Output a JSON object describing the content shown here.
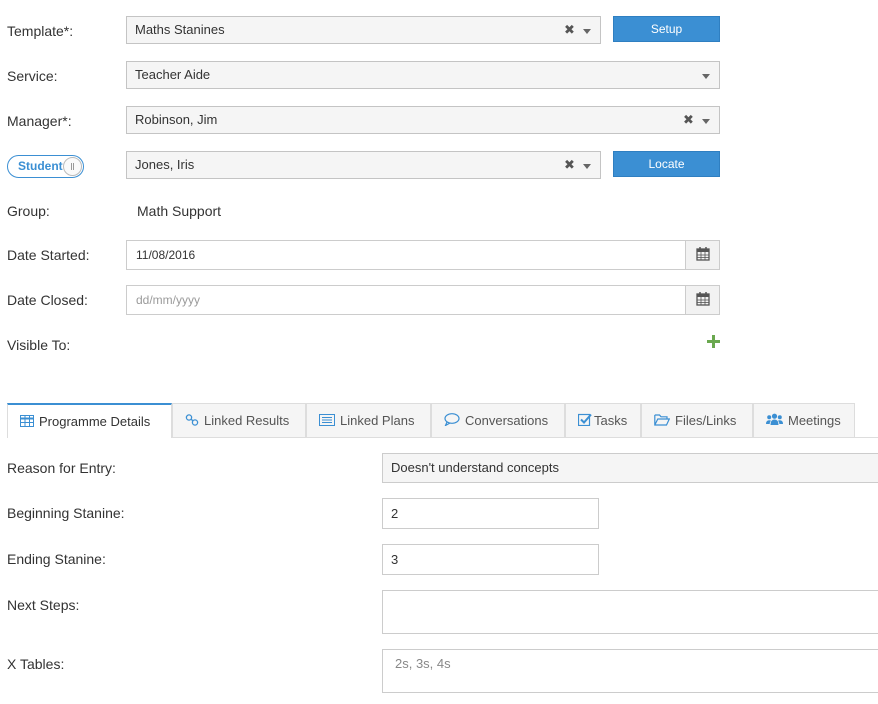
{
  "form": {
    "template": {
      "label": "Template*:",
      "value": "Maths Stanines",
      "button": "Setup"
    },
    "service": {
      "label": "Service:",
      "value": "Teacher Aide"
    },
    "manager": {
      "label": "Manager*:",
      "value": "Robinson, Jim"
    },
    "student": {
      "toggle_label": "Student",
      "value": "Jones, Iris",
      "button": "Locate"
    },
    "group": {
      "label": "Group:",
      "value": "Math Support"
    },
    "date_started": {
      "label": "Date Started:",
      "value": "11/08/2016"
    },
    "date_closed": {
      "label": "Date Closed:",
      "placeholder": "dd/mm/yyyy"
    },
    "visible_to": {
      "label": "Visible To:"
    }
  },
  "tabs": [
    {
      "label": "Programme Details",
      "icon": "table-icon",
      "active": true
    },
    {
      "label": "Linked Results",
      "icon": "link-icon"
    },
    {
      "label": "Linked Plans",
      "icon": "list-icon"
    },
    {
      "label": "Conversations",
      "icon": "comment-icon"
    },
    {
      "label": "Tasks",
      "icon": "checkbox-icon"
    },
    {
      "label": "Files/Links",
      "icon": "folder-icon"
    },
    {
      "label": "Meetings",
      "icon": "users-icon"
    }
  ],
  "details": {
    "reason": {
      "label": "Reason for Entry:",
      "value": "Doesn't understand concepts"
    },
    "beginning": {
      "label": "Beginning Stanine:",
      "value": "2"
    },
    "ending": {
      "label": "Ending Stanine:",
      "value": "3"
    },
    "next_steps": {
      "label": "Next Steps:",
      "value": ""
    },
    "x_tables": {
      "label": "X Tables:",
      "value": "2s, 3s, 4s"
    }
  },
  "colors": {
    "accent": "#3b8fd3",
    "add": "#6aa84f"
  }
}
